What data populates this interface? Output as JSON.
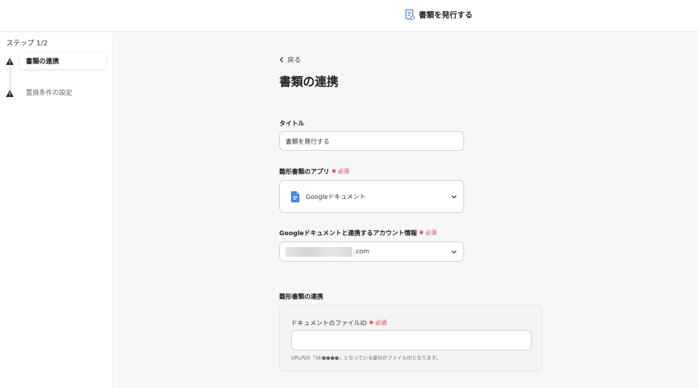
{
  "header": {
    "title": "書類を発行する",
    "icon": "document-icon"
  },
  "sidebar": {
    "step_count": "ステップ 1/2",
    "steps": [
      {
        "label": "書類の連携",
        "status": "warning",
        "active": true
      },
      {
        "label": "置換条件の設定",
        "status": "warning",
        "active": false
      }
    ]
  },
  "main": {
    "back_label": "戻る",
    "page_title": "書類の連携",
    "title_field": {
      "label": "タイトル",
      "value": "書類を発行する"
    },
    "template_app": {
      "label": "雛形書類のアプリ",
      "required": "必須",
      "value": "Googleドキュメント"
    },
    "account": {
      "label": "Googleドキュメントと連携するアカウント情報",
      "required": "必須",
      "value_suffix": ".com"
    },
    "template_link": {
      "section_label": "雛形書類の連携",
      "file_id_label": "ドキュメントのファイルID",
      "required": "必須",
      "file_id_value": "",
      "hint": "URL内の「/d/●●●●」となっている部分がファイルIDとなります。"
    }
  },
  "colors": {
    "required": "#e0364d",
    "google_docs": "#4285f4",
    "warning": "#222222"
  }
}
